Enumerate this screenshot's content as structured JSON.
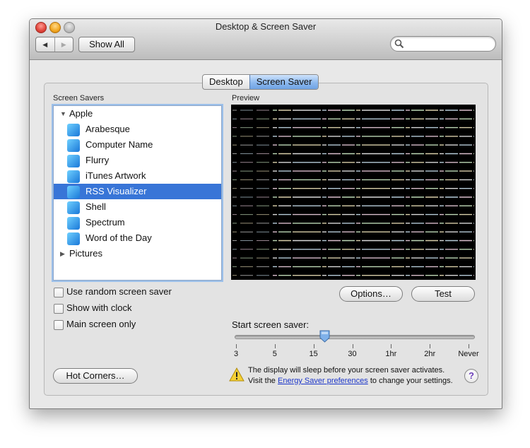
{
  "window": {
    "title": "Desktop & Screen Saver"
  },
  "toolbar": {
    "show_all_label": "Show All",
    "search_value": "",
    "search_placeholder": ""
  },
  "tabs": [
    {
      "label": "Desktop"
    },
    {
      "label": "Screen Saver",
      "selected": true
    }
  ],
  "screen_savers": {
    "heading": "Screen Savers",
    "groups": [
      {
        "label": "Apple",
        "expanded": true,
        "items": [
          {
            "label": "Arabesque"
          },
          {
            "label": "Computer Name"
          },
          {
            "label": "Flurry"
          },
          {
            "label": "iTunes Artwork"
          },
          {
            "label": "RSS Visualizer",
            "selected": true
          },
          {
            "label": "Shell"
          },
          {
            "label": "Spectrum"
          },
          {
            "label": "Word of the Day"
          }
        ]
      },
      {
        "label": "Pictures",
        "expanded": false
      }
    ]
  },
  "preview": {
    "heading": "Preview"
  },
  "buttons": {
    "options": "Options…",
    "test": "Test",
    "hot_corners": "Hot Corners…"
  },
  "checkboxes": [
    {
      "label": "Use random screen saver",
      "checked": false
    },
    {
      "label": "Show with clock",
      "checked": false
    },
    {
      "label": "Main screen only",
      "checked": false
    }
  ],
  "slider": {
    "label": "Start screen saver:",
    "ticks": [
      "3",
      "5",
      "15",
      "30",
      "1hr",
      "2hr",
      "Never"
    ],
    "value_fraction": 0.38
  },
  "warning": {
    "line1": "The display will sleep before your screen saver activates.",
    "line2_prefix": "Visit the",
    "link": "Energy Saver preferences",
    "line2_suffix": "to change your settings."
  },
  "help_label": "?"
}
